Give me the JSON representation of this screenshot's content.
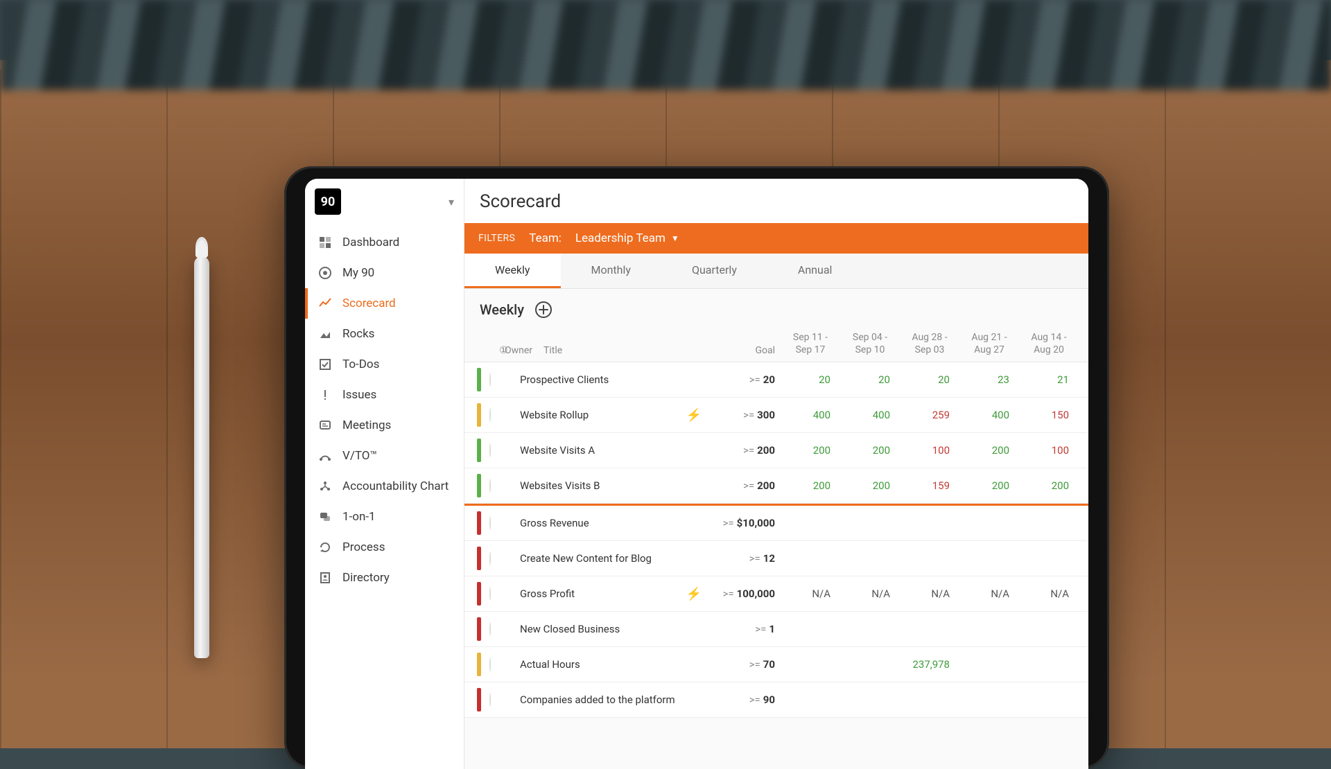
{
  "page_title": "Scorecard",
  "sidebar": {
    "items": [
      {
        "label": "Dashboard"
      },
      {
        "label": "My 90"
      },
      {
        "label": "Scorecard"
      },
      {
        "label": "Rocks"
      },
      {
        "label": "To-Dos"
      },
      {
        "label": "Issues"
      },
      {
        "label": "Meetings"
      },
      {
        "label": "V/TO™"
      },
      {
        "label": "Accountability Chart"
      },
      {
        "label": "1-on-1"
      },
      {
        "label": "Process"
      },
      {
        "label": "Directory"
      }
    ]
  },
  "filters": {
    "label": "FILTERS",
    "team_label": "Team:",
    "team_value": "Leadership Team"
  },
  "tabs": [
    "Weekly",
    "Monthly",
    "Quarterly",
    "Annual"
  ],
  "active_tab": "Weekly",
  "section_title": "Weekly",
  "columns": {
    "owner": "Owner",
    "title": "Title",
    "goal": "Goal",
    "weeks": [
      {
        "l1": "Sep 11 -",
        "l2": "Sep 17"
      },
      {
        "l1": "Sep 04 -",
        "l2": "Sep 10"
      },
      {
        "l1": "Aug 28 -",
        "l2": "Sep 03"
      },
      {
        "l1": "Aug 21 -",
        "l2": "Aug 27"
      },
      {
        "l1": "Aug 14 -",
        "l2": "Aug 20"
      }
    ]
  },
  "rows": [
    {
      "status": "green",
      "title": "Prospective Clients",
      "goal_op": ">=",
      "goal_val": "20",
      "bolt": false,
      "av": "",
      "vals": [
        {
          "v": "20",
          "c": "green"
        },
        {
          "v": "20",
          "c": "green"
        },
        {
          "v": "20",
          "c": "green"
        },
        {
          "v": "23",
          "c": "green"
        },
        {
          "v": "21",
          "c": "green"
        }
      ]
    },
    {
      "status": "amber",
      "title": "Website Rollup",
      "goal_op": ">=",
      "goal_val": "300",
      "bolt": true,
      "av": "",
      "vals": [
        {
          "v": "400",
          "c": "green"
        },
        {
          "v": "400",
          "c": "green"
        },
        {
          "v": "259",
          "c": "red"
        },
        {
          "v": "400",
          "c": "green"
        },
        {
          "v": "150",
          "c": "red"
        }
      ]
    },
    {
      "status": "green",
      "title": "Website Visits A",
      "goal_op": ">=",
      "goal_val": "200",
      "bolt": false,
      "av": "",
      "vals": [
        {
          "v": "200",
          "c": "green"
        },
        {
          "v": "200",
          "c": "green"
        },
        {
          "v": "100",
          "c": "red"
        },
        {
          "v": "200",
          "c": "green"
        },
        {
          "v": "100",
          "c": "red"
        }
      ]
    },
    {
      "status": "green",
      "title": "Websites Visits B",
      "goal_op": ">=",
      "goal_val": "200",
      "bolt": false,
      "av": "",
      "vals": [
        {
          "v": "200",
          "c": "green"
        },
        {
          "v": "200",
          "c": "green"
        },
        {
          "v": "159",
          "c": "red"
        },
        {
          "v": "200",
          "c": "green"
        },
        {
          "v": "200",
          "c": "green"
        }
      ]
    },
    {
      "status": "red",
      "sep": true,
      "title": "Gross Revenue",
      "goal_op": ">=",
      "goal_val": "$10,000",
      "bolt": false,
      "av": "alt1",
      "vals": [
        {
          "v": "",
          "c": ""
        },
        {
          "v": "",
          "c": ""
        },
        {
          "v": "",
          "c": ""
        },
        {
          "v": "",
          "c": ""
        },
        {
          "v": "",
          "c": ""
        }
      ]
    },
    {
      "status": "red",
      "title": "Create New Content for Blog",
      "goal_op": ">=",
      "goal_val": "12",
      "bolt": false,
      "av": "alt2",
      "vals": [
        {
          "v": "",
          "c": ""
        },
        {
          "v": "",
          "c": ""
        },
        {
          "v": "",
          "c": ""
        },
        {
          "v": "",
          "c": ""
        },
        {
          "v": "",
          "c": ""
        }
      ]
    },
    {
      "status": "red",
      "title": "Gross Profit",
      "goal_op": ">=",
      "goal_val": "100,000",
      "bolt": true,
      "av": "alt3",
      "vals": [
        {
          "v": "N/A",
          "c": "na"
        },
        {
          "v": "N/A",
          "c": "na"
        },
        {
          "v": "N/A",
          "c": "na"
        },
        {
          "v": "N/A",
          "c": "na"
        },
        {
          "v": "N/A",
          "c": "na"
        }
      ]
    },
    {
      "status": "red",
      "title": "New Closed Business",
      "goal_op": ">=",
      "goal_val": "1",
      "bolt": false,
      "av": "alt3",
      "vals": [
        {
          "v": "",
          "c": ""
        },
        {
          "v": "",
          "c": ""
        },
        {
          "v": "",
          "c": ""
        },
        {
          "v": "",
          "c": ""
        },
        {
          "v": "",
          "c": ""
        }
      ]
    },
    {
      "status": "amber",
      "title": "Actual Hours",
      "goal_op": ">=",
      "goal_val": "70",
      "bolt": false,
      "av": "alt1",
      "vals": [
        {
          "v": "",
          "c": ""
        },
        {
          "v": "",
          "c": ""
        },
        {
          "v": "237,978",
          "c": "green"
        },
        {
          "v": "",
          "c": ""
        },
        {
          "v": "",
          "c": ""
        }
      ]
    },
    {
      "status": "red",
      "title": "Companies added to the platform",
      "goal_op": ">=",
      "goal_val": "90",
      "bolt": false,
      "av": "",
      "vals": [
        {
          "v": "",
          "c": ""
        },
        {
          "v": "",
          "c": ""
        },
        {
          "v": "",
          "c": ""
        },
        {
          "v": "",
          "c": ""
        },
        {
          "v": "",
          "c": ""
        }
      ]
    }
  ]
}
